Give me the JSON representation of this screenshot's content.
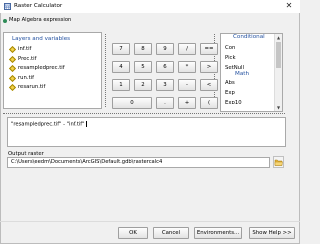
{
  "window": {
    "title": "Raster Calculator",
    "close_glyph": "✕",
    "icon": "calculator-icon"
  },
  "header": {
    "label": "Map Algebra expression"
  },
  "layers_panel": {
    "title": "Layers and variables",
    "items": [
      "inf.tif",
      "Prec.tif",
      "resampledprec.tif",
      "run.tif",
      "resarun.tif"
    ]
  },
  "keypad": {
    "keys": [
      "7",
      "8",
      "9",
      "/",
      "==",
      "!=",
      "&",
      "4",
      "5",
      "6",
      "*",
      ">",
      ">=",
      "|",
      "1",
      "2",
      "3",
      "-",
      "<",
      "<=",
      "^",
      "0",
      ".",
      "+",
      "(",
      ")",
      "~"
    ]
  },
  "conditional_panel": {
    "title": "Conditional",
    "items": [
      "Con",
      "Pick",
      "SetNull"
    ],
    "math_title": "Math",
    "math_items": [
      "Abs",
      "Exp",
      "Exp10"
    ],
    "scroll_up": "▲",
    "scroll_down": "▼"
  },
  "expression": {
    "value": "\"resampledprec.tif\" - \"inf.tif\""
  },
  "output": {
    "label": "Output raster",
    "value": "C:\\Users\\eedm\\Documents\\ArcGIS\\Default.gdb\\rastercalc4"
  },
  "buttons": {
    "ok": "OK",
    "cancel": "Cancel",
    "environments": "Environments...",
    "help": "Show Help >>"
  }
}
